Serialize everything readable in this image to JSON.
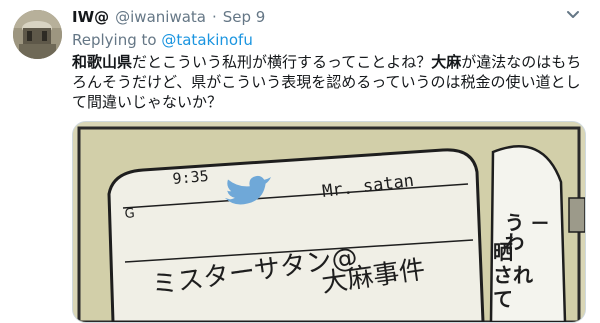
{
  "tweet": {
    "author": {
      "display_name": "IW@",
      "handle": "@iwaniwata"
    },
    "separator": "·",
    "date": "Sep 9",
    "reply": {
      "prefix": "Replying to",
      "mention": "@tatakinofu"
    },
    "text": {
      "line1_bold1": "和歌山県",
      "line1_rest1": "だとこういう私刑が横行するってことよね？",
      "line1_bold2": "大麻",
      "line1_rest2": "が違法なのはもち",
      "line2": "ろんそうだけど、県がこういう表現を認めるっていうのは税金の使い道とし",
      "line3": "て間違いじゃないか？"
    },
    "media": {
      "phone_time": "9:35",
      "phone_signal": "G",
      "phone_handle": "Mr. satan",
      "phone_name_line": "ミスターサタン@",
      "phone_headline": "大麻事件",
      "speech_bubble": [
        "うわ",
        "ー",
        "晒",
        "され",
        "て"
      ]
    },
    "icons": [
      "avatar",
      "chevron-down-icon",
      "twitter-bird-icon"
    ]
  }
}
